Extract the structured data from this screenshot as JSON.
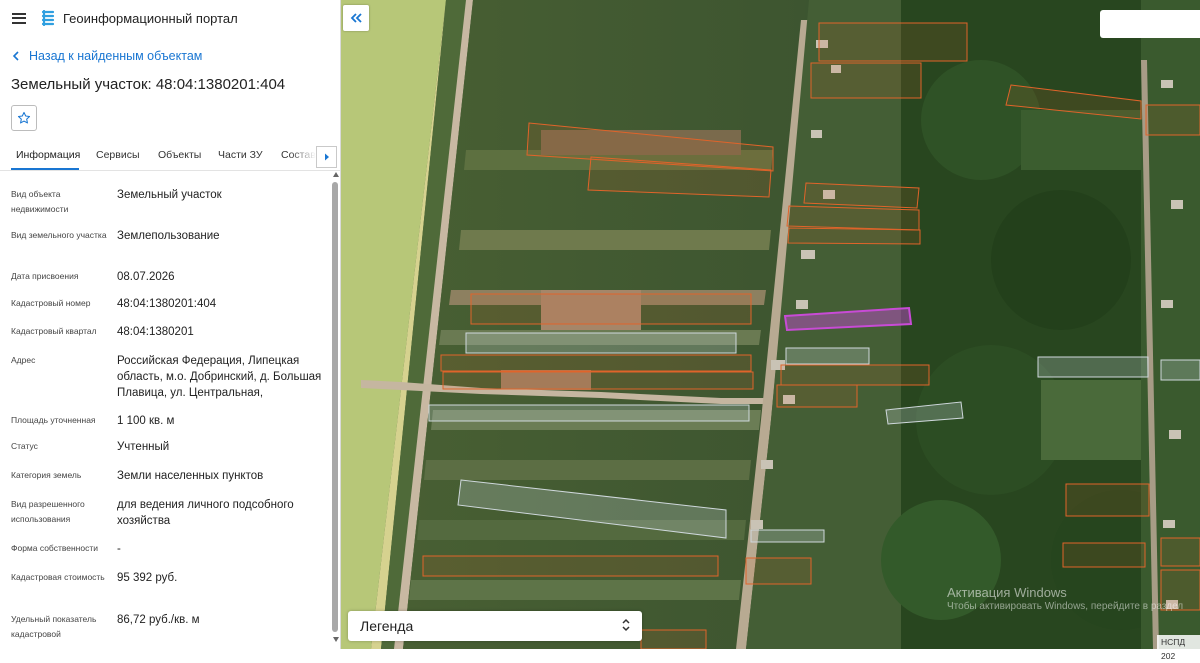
{
  "app": {
    "title": "Геоинформационный портал"
  },
  "nav": {
    "back_label": "Назад к найденным объектам"
  },
  "object": {
    "title": "Земельный участок: 48:04:1380201:404"
  },
  "tabs": [
    {
      "label": "Информация"
    },
    {
      "label": "Сервисы"
    },
    {
      "label": "Объекты"
    },
    {
      "label": "Части ЗУ"
    },
    {
      "label": "Состав"
    }
  ],
  "properties": [
    {
      "label": "Вид объекта недвижимости",
      "value": "Земельный участок"
    },
    {
      "label": "Вид земельного участка",
      "value": "Землепользование"
    },
    {
      "label": "Дата присвоения",
      "value": "08.07.2026"
    },
    {
      "label": "Кадастровый номер",
      "value": "48:04:1380201:404"
    },
    {
      "label": "Кадастровый квартал",
      "value": "48:04:1380201"
    },
    {
      "label": "Адрес",
      "value": "Российская Федерация, Липецкая область, м.о. Добринский, д. Большая Плавица, ул. Центральная,"
    },
    {
      "label": "Площадь уточненная",
      "value": "1 100 кв. м"
    },
    {
      "label": "Статус",
      "value": "Учтенный"
    },
    {
      "label": "Категория земель",
      "value": "Земли населенных пунктов"
    },
    {
      "label": "Вид разрешенного использования",
      "value": "для ведения личного подсобного хозяйства"
    },
    {
      "label": "Форма собственности",
      "value": "-"
    },
    {
      "label": "Кадастровая стоимость",
      "value": "95 392 руб."
    },
    {
      "label": "Удельный показатель кадастровой",
      "value": "86,72 руб./кв. м"
    }
  ],
  "map": {
    "legend_label": "Легенда",
    "watermark_title": "Активация Windows",
    "watermark_sub": "Чтобы активировать Windows, перейдите в раздел",
    "credit": "НСПД 202"
  },
  "colors": {
    "accent": "#1976d2",
    "parcel_outline": "#e0642a",
    "selected_parcel": "#c84bd6",
    "other_parcel": "#cfd8dc"
  },
  "icons": {
    "menu": "hamburger-icon",
    "logo": "portal-logo",
    "back": "chevron-left-icon",
    "favorite": "star-outline-icon",
    "tabs_next": "chevron-right-icon",
    "collapse": "double-chevron-left-icon",
    "legend_toggle": "unfold-icon"
  }
}
